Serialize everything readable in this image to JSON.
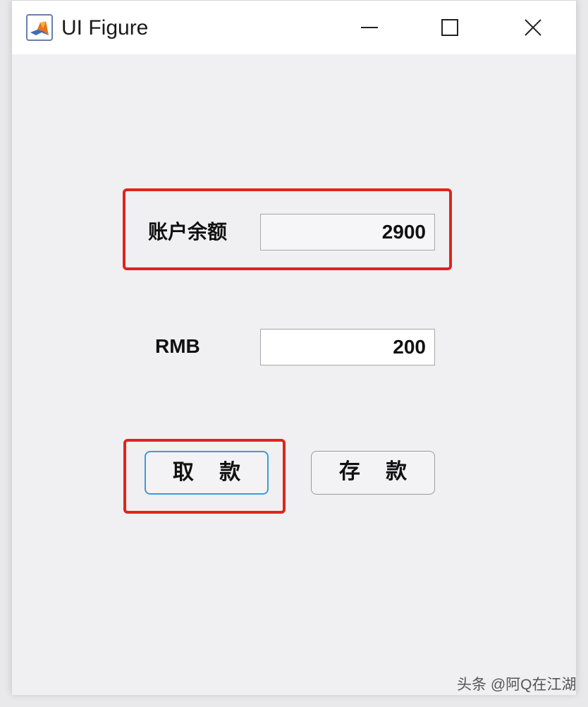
{
  "window": {
    "title": "UI Figure",
    "icon": "matlab-logo-icon",
    "controls": [
      "minimize-icon",
      "maximize-icon",
      "close-icon"
    ]
  },
  "form": {
    "balance_label": "账户余额",
    "balance_value": "2900",
    "amount_label": "RMB",
    "amount_value": "200",
    "withdraw_label": "取 款",
    "deposit_label": "存 款"
  },
  "annotations": {
    "highlight_color": "#e0241c"
  },
  "watermark": "头条 @阿Q在江湖"
}
